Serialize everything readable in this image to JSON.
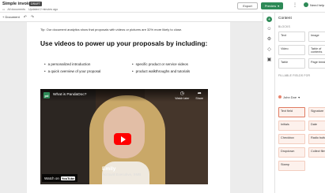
{
  "header": {
    "title": "Simple invoice",
    "badge": "DRAFT",
    "breadcrumb": "All documents",
    "updated": "Updated 2 minutes ago",
    "export_label": "Export",
    "preview_label": "Preview",
    "more_label": "⋮",
    "help_label": "Need help"
  },
  "toolbar": {
    "document_label": "Document",
    "undo_icon": "undo-icon",
    "redo_icon": "redo-icon"
  },
  "page": {
    "tip": "Tip: Our document analytics show that proposals with videos or pictures are 32% more likely to close.",
    "heading": "Use videos to power up your proposals by including:",
    "bullets_left": [
      "a personalized introduction",
      "a quick overview of your proposal"
    ],
    "bullets_right": [
      "specific product or service videos",
      "product walkthroughs and tutorials"
    ]
  },
  "video": {
    "title": "What is PandaDoc?",
    "watch_later": "Watch later",
    "share": "Share",
    "name": "Emily",
    "role": "Account Executive, SMB",
    "watch_on": "Watch on",
    "youtube": "YouTube"
  },
  "panel": {
    "title": "Content",
    "blocks_section": "BLOCKS",
    "blocks": [
      "Text",
      "Image",
      "Video",
      "Table of contents",
      "Table",
      "Page break"
    ],
    "fields_section": "FILLABLE FIELDS FOR",
    "recipient": "John Doe",
    "fields": [
      "Text field",
      "Signature",
      "Initials",
      "Date",
      "Checkbox",
      "Radio buttons",
      "Dropdown",
      "Collect files",
      "Stamp"
    ]
  },
  "colors": {
    "accent": "#2e8a57",
    "field_bg": "#fdf1ec",
    "field_border": "#f3cdbf"
  }
}
